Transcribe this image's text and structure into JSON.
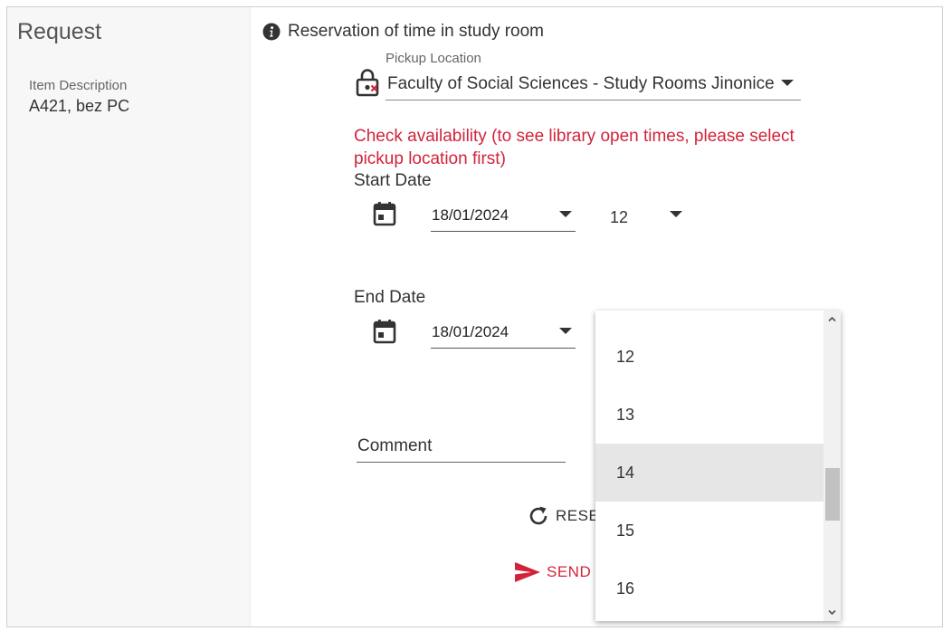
{
  "sidebar": {
    "title": "Request",
    "item_description_label": "Item Description",
    "item_description_value": "A421, bez PC"
  },
  "form": {
    "title": "Reservation of time in study room",
    "pickup": {
      "label": "Pickup Location",
      "value": "Faculty of Social Sciences - Study Rooms Jinonice"
    },
    "availability_warning": "Check availability (to see library open times, please select pickup location first)",
    "start": {
      "label": "Start Date",
      "date": "18/01/2024",
      "hour": "12"
    },
    "end": {
      "label": "End Date",
      "date": "18/01/2024"
    },
    "comment_label": "Comment",
    "reset_label": "RESE",
    "send_label": "SEND"
  },
  "hour_dropdown": {
    "options": [
      "12",
      "13",
      "14",
      "15",
      "16"
    ],
    "highlighted": "14"
  },
  "colors": {
    "accent": "#d2233b",
    "sidebar_bg": "#f7f7f7",
    "highlight_bg": "#e6e6e6"
  }
}
